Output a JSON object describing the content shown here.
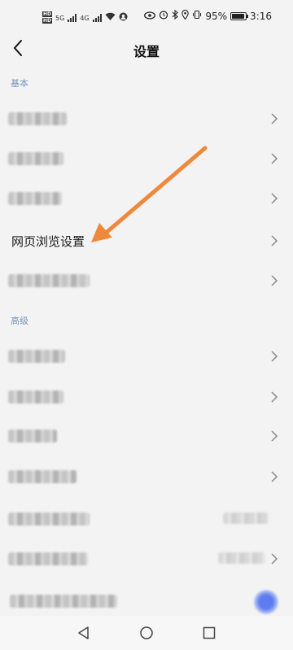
{
  "status_bar": {
    "sim1": "HD",
    "sim2": "HD",
    "net1": "5G",
    "net2": "4G",
    "battery_percent": "95%",
    "battery_level": 0.95,
    "time": "3:16",
    "icons": [
      "eye-icon",
      "alarm-icon",
      "bluetooth-icon",
      "location-icon",
      "vibrate-icon"
    ]
  },
  "header": {
    "title": "设置"
  },
  "sections": [
    {
      "title": "基本",
      "rows": [
        {
          "label": "",
          "blurred": true
        },
        {
          "label": "",
          "blurred": true
        },
        {
          "label": "",
          "blurred": true
        },
        {
          "label": "网页浏览设置",
          "blurred": false
        },
        {
          "label": "",
          "blurred": true
        }
      ]
    },
    {
      "title": "高级",
      "rows": [
        {
          "label": "",
          "blurred": true
        },
        {
          "label": "",
          "blurred": true
        },
        {
          "label": "",
          "blurred": true
        },
        {
          "label": "",
          "blurred": true
        },
        {
          "label": "",
          "blurred": true
        },
        {
          "label": "",
          "blurred": true
        },
        {
          "label": "",
          "blurred": true
        }
      ]
    }
  ],
  "annotation": {
    "color": "#f0883b"
  },
  "colors": {
    "background": "#f3f3f3",
    "section_title": "#7a95b8",
    "chevron": "#8a8a8a"
  }
}
